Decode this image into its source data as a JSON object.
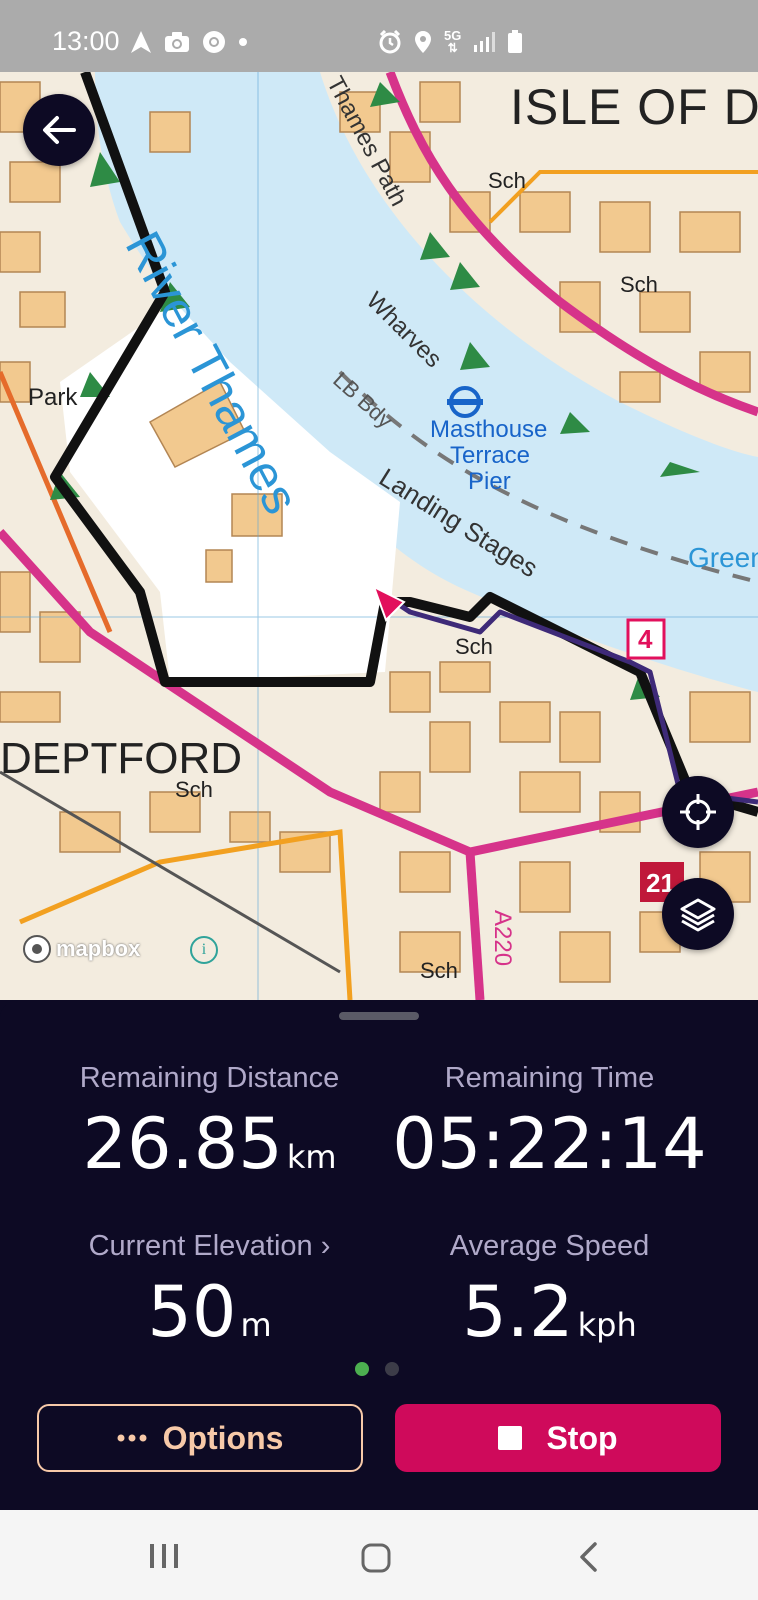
{
  "status_bar": {
    "time": "13:00",
    "left_icons": [
      "navigation-arrow-icon",
      "camera-icon",
      "chrome-icon",
      "dot-icon"
    ],
    "right_icons": [
      "alarm-icon",
      "location-pin-icon",
      "5g-icon",
      "signal-icon",
      "battery-icon"
    ],
    "network_label": "5G"
  },
  "map": {
    "labels": {
      "isle_of": "ISLE OF D",
      "river": "River Thames",
      "thames_path": "Thames Path",
      "wharves": "Wharves",
      "lb_bdy": "LB Bdy",
      "masthouse": "Masthouse",
      "terrace": "Terrace",
      "pier": "Pier",
      "landing_stages": "Landing Stages",
      "green": "Green",
      "park": "Park",
      "deptford": "DEPTFORD",
      "sch_1": "Sch",
      "sch_2": "Sch",
      "sch_3": "Sch",
      "sch_4": "Sch",
      "sch_5": "Sch",
      "road_a220": "A220",
      "marker_4": "4",
      "marker_21": "21"
    },
    "attribution": "mapbox",
    "colors": {
      "water": "#cfe9f7",
      "land": "#f3ecdf",
      "building": "#f2c98f",
      "route": "#111111",
      "track": "#3e2a78",
      "primary_road": "#d6338a",
      "secondary_road": "#f2a020"
    }
  },
  "controls": {
    "back_icon": "arrow-left-icon",
    "locate_icon": "crosshair-icon",
    "layers_icon": "layers-icon"
  },
  "stats": {
    "remaining_distance": {
      "label": "Remaining Distance",
      "value": "26.85",
      "unit": "km"
    },
    "remaining_time": {
      "label": "Remaining Time",
      "value": "05:22:14",
      "unit": ""
    },
    "current_elevation": {
      "label": "Current Elevation ›",
      "value": "50",
      "unit": "m"
    },
    "average_speed": {
      "label": "Average Speed",
      "value": "5.2",
      "unit": "kph"
    }
  },
  "pager": {
    "active_color": "#4caf50",
    "inactive_color": "#3c3c48",
    "pages": 2,
    "current": 1
  },
  "buttons": {
    "options": {
      "label": "Options",
      "icon": "more-dots-icon",
      "color": "#f7c9a8"
    },
    "stop": {
      "label": "Stop",
      "icon": "stop-square-icon",
      "color": "#cf0a5b"
    }
  },
  "nav_bar": {
    "icons": [
      "recent-apps-icon",
      "home-icon",
      "back-icon"
    ]
  }
}
